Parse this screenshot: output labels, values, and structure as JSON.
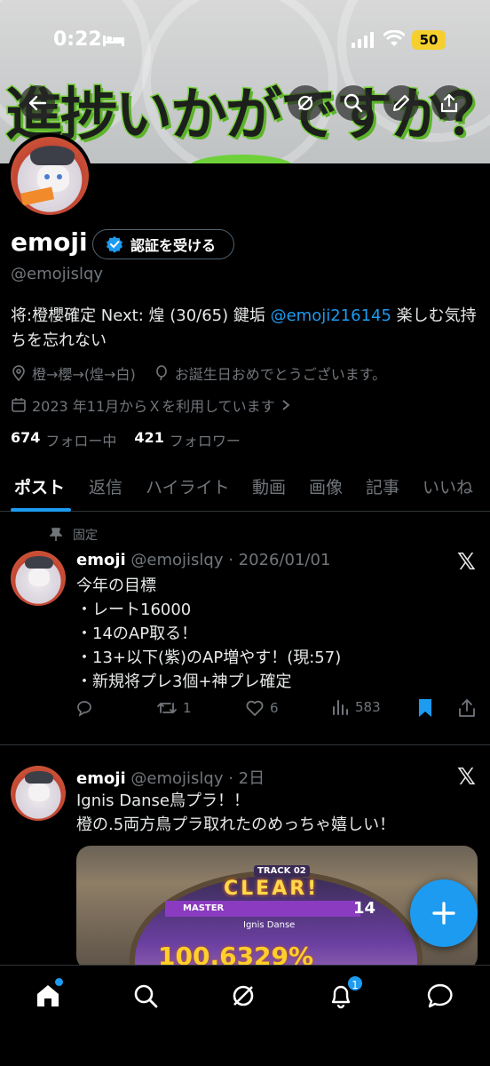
{
  "status_bar": {
    "time": "0:22",
    "battery": "50"
  },
  "banner": {
    "text": "進捗いかがですか？"
  },
  "profile": {
    "name": "emoji",
    "verify_button": "認証を受ける",
    "handle": "@emojislqy",
    "bio_text": "将:橙櫻確定 Next: 煌 (30/65) 鍵垢 ",
    "bio_mention": "@emoji216145",
    "bio_rest": " 楽しむ気持ちを忘れない",
    "location": "橙→櫻→(煌→白)",
    "birthday": "お誕生日おめでとうございます。",
    "joined": "2023 年11月からＸを利用しています",
    "following_count": "674",
    "following_label": "フォロー中",
    "followers_count": "421",
    "followers_label": "フォロワー"
  },
  "tabs": [
    "ポスト",
    "返信",
    "ハイライト",
    "動画",
    "画像",
    "記事",
    "いいね"
  ],
  "posts": [
    {
      "pinned_label": "固定",
      "name": "emoji",
      "handle_date": "@emojislqy · 2026/01/01",
      "lines": [
        "今年の目標",
        "・レート16000",
        "・14のAP取る！",
        "・13+以下(紫)のAP増やす！(現:57)",
        "・新規将プレ3個+神プレ確定"
      ],
      "reposts": "1",
      "likes": "6",
      "views": "583"
    },
    {
      "name": "emoji",
      "handle_date": "@emojislqy · 2日",
      "lines": [
        "Ignis Danse鳥プラ！！",
        "橙の.5両方鳥プラ取れたのめっちゃ嬉しい！"
      ],
      "media": {
        "track": "TRACK 02",
        "clear": "CLEAR!",
        "difficulty": "MASTER",
        "song": "Ignis Danse",
        "level": "14",
        "score": "100.6329%"
      }
    }
  ],
  "bottom_nav": {
    "notifications_badge": "1"
  },
  "colors": {
    "accent": "#1d9bf0",
    "muted": "#71767b",
    "background": "#000000"
  }
}
